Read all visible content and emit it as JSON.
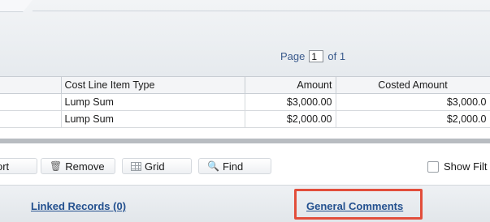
{
  "pager": {
    "label": "Page",
    "current": "1",
    "of_label": "of 1"
  },
  "table": {
    "headers": [
      "",
      "Cost Line Item Type",
      "Amount",
      "Costed Amount"
    ],
    "rows": [
      [
        "",
        "Lump Sum",
        "$3,000.00",
        "$3,000.0"
      ],
      [
        "",
        "Lump Sum",
        "$2,000.00",
        "$2,000.0"
      ]
    ]
  },
  "toolbar": {
    "export_label": "ort",
    "remove_label": "Remove",
    "grid_label": "Grid",
    "find_label": "Find",
    "show_filter_label": "Show Filt"
  },
  "tabs": {
    "linked_records": "Linked Records (0)",
    "general_comments": "General Comments"
  },
  "colors": {
    "highlight": "#e24e3b",
    "link": "#23508f"
  }
}
